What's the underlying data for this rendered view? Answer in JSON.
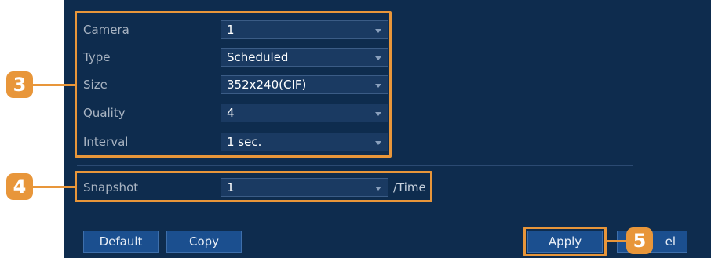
{
  "settings": {
    "rows": [
      {
        "label": "Camera",
        "value": "1"
      },
      {
        "label": "Type",
        "value": "Scheduled"
      },
      {
        "label": "Size",
        "value": "352x240(CIF)"
      },
      {
        "label": "Quality",
        "value": "4"
      },
      {
        "label": "Interval",
        "value": "1 sec."
      }
    ],
    "snapshot": {
      "label": "Snapshot",
      "value": "1",
      "unit": "/Time"
    }
  },
  "buttons": {
    "default": "Default",
    "copy": "Copy",
    "apply": "Apply",
    "cancel_partial": "el"
  },
  "callouts": {
    "three": "3",
    "four": "4",
    "five": "5"
  },
  "colors": {
    "panel_bg": "#0e2c4e",
    "callout": "#e8963a",
    "button": "#1b4f8f"
  }
}
